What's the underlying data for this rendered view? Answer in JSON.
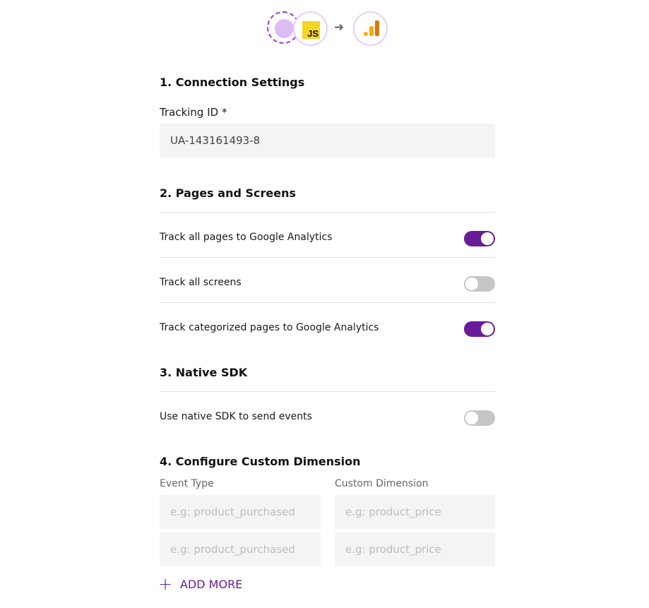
{
  "header": {
    "js_badge_text": "JS",
    "arrow_icon": "right-arrow-icon"
  },
  "connection": {
    "title": "1. Connection Settings",
    "tracking_label": "Tracking ID *",
    "tracking_value": "UA-143161493-8"
  },
  "pages": {
    "title": "2. Pages and Screens",
    "toggles": [
      {
        "label": "Track all pages to Google Analytics",
        "on": true
      },
      {
        "label": "Track all screens",
        "on": false
      },
      {
        "label": "Track categorized pages to Google Analytics",
        "on": true
      }
    ]
  },
  "native": {
    "title": "3. Native SDK",
    "toggles": [
      {
        "label": "Use native SDK to send events",
        "on": false
      }
    ]
  },
  "dimensions": {
    "title": "4. Configure Custom Dimension",
    "event_type_label": "Event Type",
    "custom_dimension_label": "Custom Dimension",
    "event_placeholder": "e.g: product_purchased",
    "dimension_placeholder": "e.g: product_price",
    "add_more_label": "ADD MORE"
  },
  "colors": {
    "accent": "#6a1b9a",
    "toggle_off": "#c6c6c6",
    "input_bg": "#f4f4f4"
  }
}
